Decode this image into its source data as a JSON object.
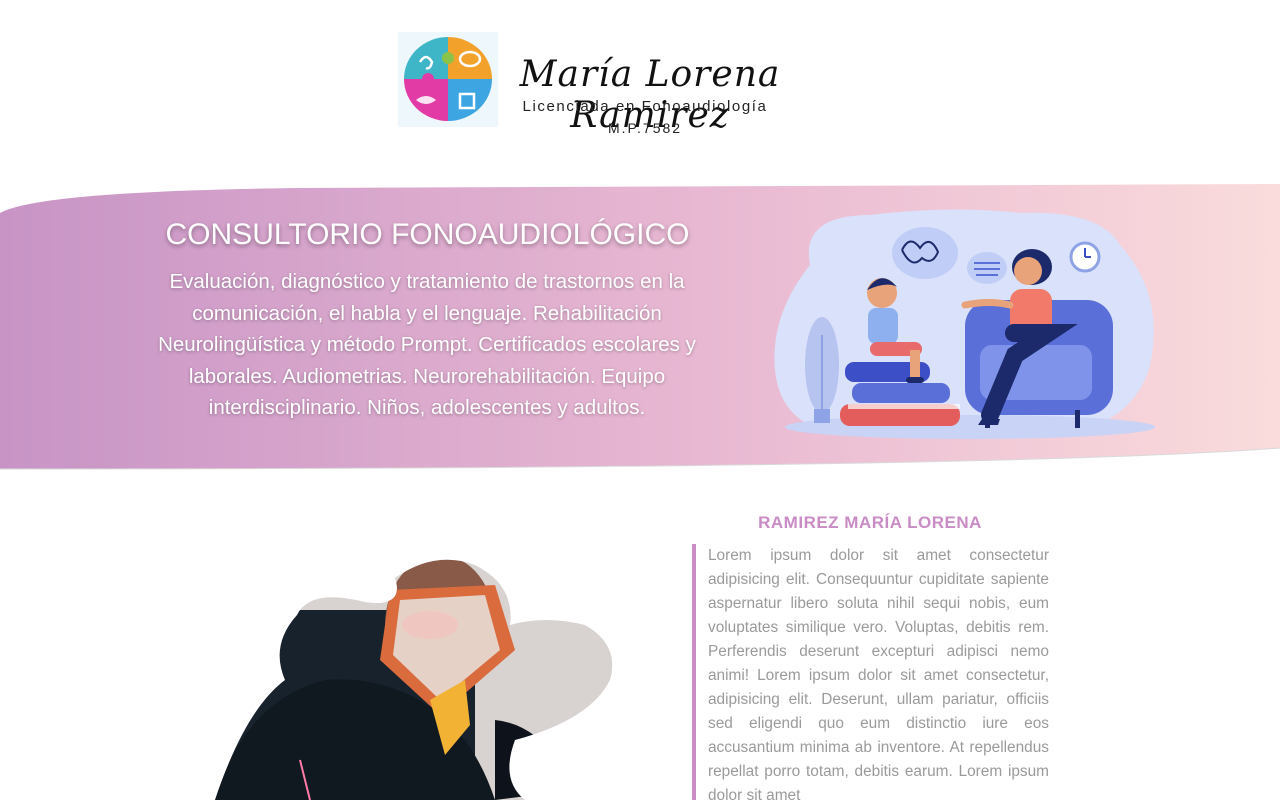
{
  "header": {
    "brand_name": "María Lorena Ramirez",
    "brand_subtitle": "Licenciada en Fonoaudiología",
    "license": "M.P.7582"
  },
  "hero": {
    "title": "CONSULTORIO FONOAUDIOLÓGICO",
    "description": "Evaluación, diagnóstico y tratamiento de trastornos en la comunicación, el habla y el lenguaje. Rehabilitación Neurolingüística y método Prompt. Certificados escolares y laborales. Audiometrias. Neurorehabilitación. Equipo interdisciplinario. Niños, adolescentes y adultos."
  },
  "about": {
    "title": "RAMIREZ MARÍA LORENA",
    "text": "Lorem ipsum dolor sit amet consectetur adipisicing elit. Consequuntur cupiditate sapiente aspernatur libero soluta nihil sequi nobis, eum voluptates similique vero. Voluptas, debitis rem. Perferendis deserunt excepturi adipisci nemo animi! Lorem ipsum dolor sit amet consectetur, adipisicing elit. Deserunt, ullam pariatur, officiis sed eligendi quo eum distinctio iure eos accusantium minima ab inventore. At repellendus repellat porro totam, debitis earum. Lorem ipsum dolor sit amet"
  },
  "icons": {
    "logo": "puzzle-logo-icon",
    "hero_image": "speech-therapy-illustration",
    "portrait": "therapist-photo"
  },
  "colors": {
    "accent": "#c98cc4",
    "hero_gradient_start": "#c794c5",
    "hero_gradient_end": "#fadcdc",
    "body_text": "#9a9a9a"
  }
}
